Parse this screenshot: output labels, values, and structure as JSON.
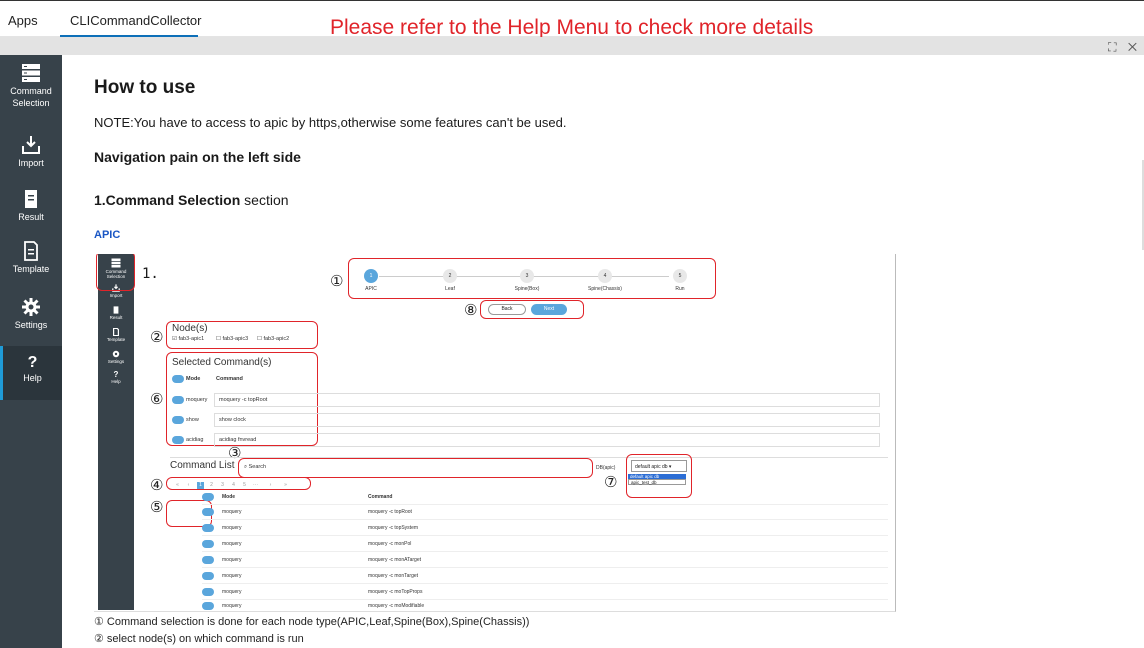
{
  "topbar": {
    "apps": "Apps",
    "app_tab": "CLICommandCollector",
    "banner": "Please refer to the Help Menu to check more details",
    "window_controls": "⛶ ✕"
  },
  "sidebar": {
    "items": [
      {
        "label": "Command\nSelection",
        "icon": "server-icon"
      },
      {
        "label": "Import",
        "icon": "import-icon"
      },
      {
        "label": "Result",
        "icon": "document-icon"
      },
      {
        "label": "Template",
        "icon": "template-icon"
      },
      {
        "label": "Settings",
        "icon": "gear-icon"
      },
      {
        "label": "Help",
        "icon": "question-icon"
      }
    ]
  },
  "content": {
    "title": "How to use",
    "note": "NOTE:You have to access to apic by https,otherwise some features can't be used.",
    "nav_heading": "Navigation pain on the left side",
    "section_bold": "1.Command Selection",
    "section_rest": " section",
    "apic_label": "APIC",
    "caption1": "① Command selection is done for each node type(APIC,Leaf,Spine(Box),Spine(Chassis))",
    "caption2": "② select node(s) on which command is run"
  },
  "screenshot": {
    "mini_sidebar": [
      "Command Selection",
      "Import",
      "Result",
      "Template",
      "Settings",
      "Help"
    ],
    "mini_help_glyph": "?",
    "step_index": "1.",
    "markers": [
      "①",
      "②",
      "③",
      "④",
      "⑤",
      "⑥",
      "⑦",
      "⑧"
    ],
    "steps": [
      {
        "n": "1",
        "label": "APIC"
      },
      {
        "n": "2",
        "label": "Leaf"
      },
      {
        "n": "3",
        "label": "Spine(Box)"
      },
      {
        "n": "4",
        "label": "Spine(Chassis)"
      },
      {
        "n": "5",
        "label": "Run"
      }
    ],
    "back": "Back",
    "next": "Next",
    "nodes_title": "Node(s)",
    "nodes": [
      "fab3-apic1",
      "fab3-apic3",
      "fab3-apic2"
    ],
    "selected_title": "Selected Command(s)",
    "col_mode": "Mode",
    "col_command": "Command",
    "selected": [
      {
        "mode": "moquery",
        "command": "moquery -c topRoot"
      },
      {
        "mode": "show",
        "command": "show clock"
      },
      {
        "mode": "acidiag",
        "command": "acidiag fnvread"
      }
    ],
    "list_title": "Command List",
    "search_placeholder": "Search",
    "db_label": "DB(apic)",
    "db_value": "default apic db",
    "db_options": [
      "default apic db",
      "apic_test_db"
    ],
    "pagination": [
      "«",
      "‹",
      "1",
      "2",
      "3",
      "4",
      "5",
      "···",
      "›",
      "»"
    ],
    "commands": [
      {
        "mode": "moquery",
        "command": "moquery -c topRoot"
      },
      {
        "mode": "moquery",
        "command": "moquery -c topSystem"
      },
      {
        "mode": "moquery",
        "command": "moquery -c monPol"
      },
      {
        "mode": "moquery",
        "command": "moquery -c monATarget"
      },
      {
        "mode": "moquery",
        "command": "moquery -c monTarget"
      },
      {
        "mode": "moquery",
        "command": "moquery -c moTopProps"
      },
      {
        "mode": "moquery",
        "command": "moquery -c moModifiable"
      }
    ]
  }
}
